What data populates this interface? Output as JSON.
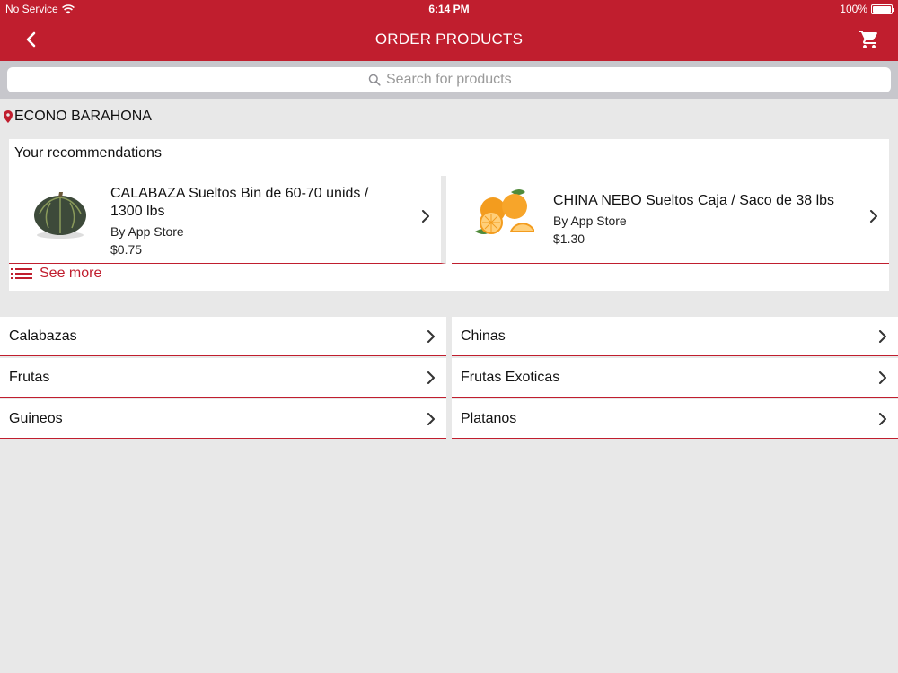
{
  "status_bar": {
    "carrier": "No Service",
    "time": "6:14 PM",
    "battery": "100%"
  },
  "nav": {
    "title": "ORDER PRODUCTS"
  },
  "search": {
    "placeholder": "Search for products"
  },
  "location": {
    "name": "ECONO BARAHONA"
  },
  "recommendations": {
    "header": "Your recommendations",
    "items": [
      {
        "name": "CALABAZA Sueltos Bin de 60-70 unids / 1300 lbs",
        "seller": "By App Store",
        "price": "$0.75"
      },
      {
        "name": "CHINA NEBO Sueltos Caja / Saco de 38 lbs",
        "seller": "By App Store",
        "price": "$1.30"
      }
    ],
    "see_more": "See more"
  },
  "categories": [
    "Calabazas",
    "Chinas",
    "Frutas",
    "Frutas Exoticas",
    "Guineos",
    "Platanos"
  ],
  "colors": {
    "accent": "#c01e2e",
    "background": "#e8e8e8"
  }
}
